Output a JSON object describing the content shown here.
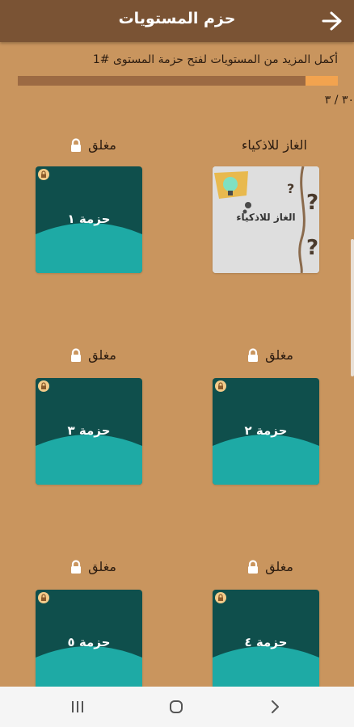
{
  "header": {
    "title": "حزم المستويات"
  },
  "progress": {
    "message": "أكمل المزيد من المستويات لفتح حزمة المستوى #1",
    "count": "٣٠ / ٣",
    "fraction": 0.1
  },
  "featured_pack": {
    "label": "الغاز للاذكياء",
    "tile_text": "الغاز للاذكياء",
    "question_marks": [
      "?",
      "?",
      "?"
    ]
  },
  "packs": [
    {
      "name": "حزمة ١",
      "status": "مغلق"
    },
    {
      "name": "حزمة ٢",
      "status": "مغلق"
    },
    {
      "name": "حزمة ٣",
      "status": "مغلق"
    },
    {
      "name": "حزمة ٤",
      "status": "مغلق"
    },
    {
      "name": "حزمة ٥",
      "status": "مغلق"
    }
  ],
  "icons": {
    "back": "arrow-back-icon",
    "lock": "lock-icon",
    "nav_recents": "recents-icon",
    "nav_home": "home-icon",
    "nav_back": "chevron-back-icon"
  },
  "colors": {
    "background": "#c9955e",
    "appbar": "#7a5334",
    "tile_dark": "#0f4f4c",
    "tile_light": "#1eaaa5",
    "progress_fill": "#f2a34f"
  }
}
